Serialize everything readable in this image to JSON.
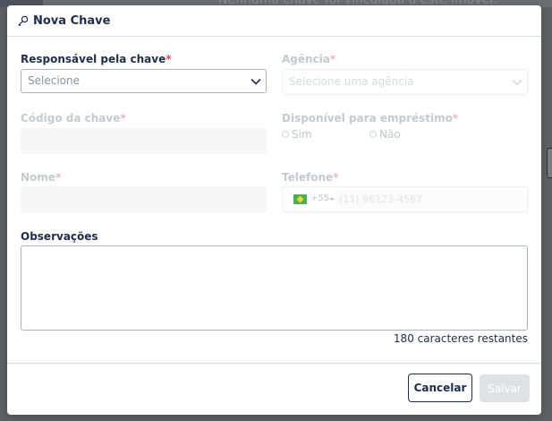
{
  "backdrop": {
    "text": "Nenhuma chave foi vinculada a este imóvel."
  },
  "modal": {
    "title": "Nova Chave",
    "title_icon": "key-icon"
  },
  "form": {
    "responsavel": {
      "label": "Responsável pela chave",
      "required": "*",
      "placeholder": "Selecione"
    },
    "agencia": {
      "label": "Agência",
      "required": "*",
      "placeholder": "Selecione uma agência"
    },
    "codigo": {
      "label": "Código da chave",
      "required": "*",
      "value": ""
    },
    "disponivel": {
      "label": "Disponível para empréstimo",
      "required": "*",
      "options": [
        "Sim",
        "Não"
      ]
    },
    "nome": {
      "label": "Nome",
      "required": "*",
      "value": ""
    },
    "telefone": {
      "label": "Telefone",
      "required": "*",
      "country_code": "+55",
      "placeholder": "(11) 96123-4567"
    },
    "observacoes": {
      "label": "Observações",
      "value": "",
      "counter": "180 caracteres restantes"
    }
  },
  "buttons": {
    "cancel": "Cancelar",
    "save": "Salvar"
  },
  "colors": {
    "primary": "#1f2d4a",
    "required": "#e0445a",
    "disabled_button": "#dfe1e5"
  }
}
